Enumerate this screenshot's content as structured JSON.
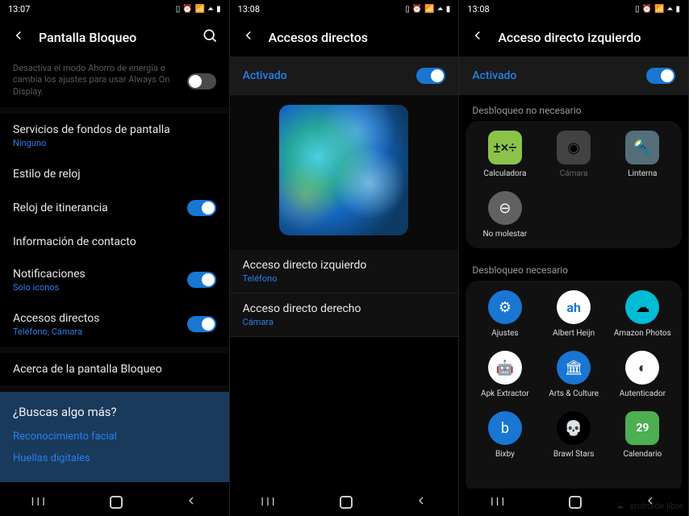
{
  "phone1": {
    "time": "13:07",
    "title": "Pantalla Bloqueo",
    "aod_hint": "Desactiva el modo Ahorro de energía o cambia los ajustes para usar Always On Display.",
    "wallpaper_services": "Servicios de fondos de pantalla",
    "wallpaper_services_sub": "Ninguno",
    "clock_style": "Estilo de reloj",
    "roaming_clock": "Reloj de itinerancia",
    "contact_info": "Información de contacto",
    "notifications": "Notificaciones",
    "notifications_sub": "Solo iconos",
    "shortcuts": "Accesos directos",
    "shortcuts_sub": "Teléfono, Cámara",
    "about": "Acerca de la pantalla Bloqueo",
    "more_title": "¿Buscas algo más?",
    "more_face": "Reconocimiento facial",
    "more_finger": "Huellas digitales"
  },
  "phone2": {
    "time": "13:08",
    "title": "Accesos directos",
    "activado": "Activado",
    "left_title": "Acceso directo izquierdo",
    "left_sub": "Teléfono",
    "right_title": "Acceso directo derecho",
    "right_sub": "Cámara"
  },
  "phone3": {
    "time": "13:08",
    "title": "Acceso directo izquierdo",
    "activado": "Activado",
    "section1": "Desbloqueo no necesario",
    "section2": "Desbloqueo necesario",
    "apps1": [
      {
        "name": "Calculadora",
        "icon": "calc"
      },
      {
        "name": "Cámara",
        "icon": "cam"
      },
      {
        "name": "Linterna",
        "icon": "flash"
      },
      {
        "name": "No molestar",
        "icon": "dnd"
      }
    ],
    "apps2": [
      {
        "name": "Ajustes",
        "icon": "ajustes"
      },
      {
        "name": "Albert Heijn",
        "icon": "ah"
      },
      {
        "name": "Amazon Photos",
        "icon": "amazon"
      },
      {
        "name": "Apk Extractor",
        "icon": "apk"
      },
      {
        "name": "Arts & Culture",
        "icon": "arts"
      },
      {
        "name": "Autenticador",
        "icon": "auth"
      },
      {
        "name": "Bixby",
        "icon": "bixby"
      },
      {
        "name": "Brawl Stars",
        "icon": "brawl"
      },
      {
        "name": "Calendario",
        "icon": "cal",
        "badge": "29"
      }
    ]
  },
  "watermark": "androide libre"
}
